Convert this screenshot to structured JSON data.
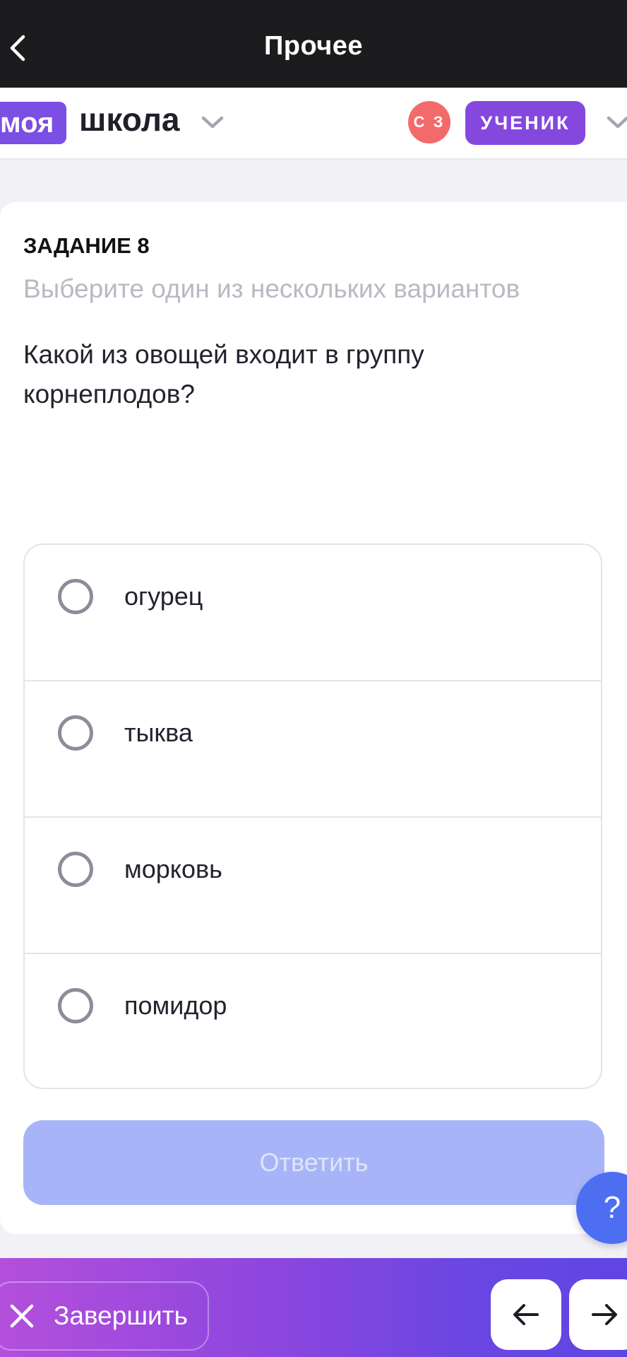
{
  "topbar": {
    "title": "Прочее",
    "back_icon": "chevron-left-icon"
  },
  "header": {
    "logo_part1": "моя",
    "logo_part2": "школа",
    "user_initials": "С З",
    "role": "УЧЕНИК"
  },
  "task": {
    "label": "ЗАДАНИЕ 8",
    "instruction": "Выберите один из нескольких вариантов",
    "question": "Какой из овощей входит в группу корнеплодов?",
    "options": [
      {
        "label": "огурец",
        "selected": false
      },
      {
        "label": "тыква",
        "selected": false
      },
      {
        "label": "морковь",
        "selected": false
      },
      {
        "label": "помидор",
        "selected": false
      }
    ],
    "answer_label": "Ответить"
  },
  "help": {
    "label": "?"
  },
  "bottombar": {
    "finish_label": "Завершить",
    "prev_icon": "arrow-left-icon",
    "next_icon": "arrow-right-icon"
  },
  "colors": {
    "accent": "#7b4ee4",
    "avatar": "#f26a6a",
    "answer_disabled": "#a7b5f8",
    "help": "#4e6ef2"
  }
}
